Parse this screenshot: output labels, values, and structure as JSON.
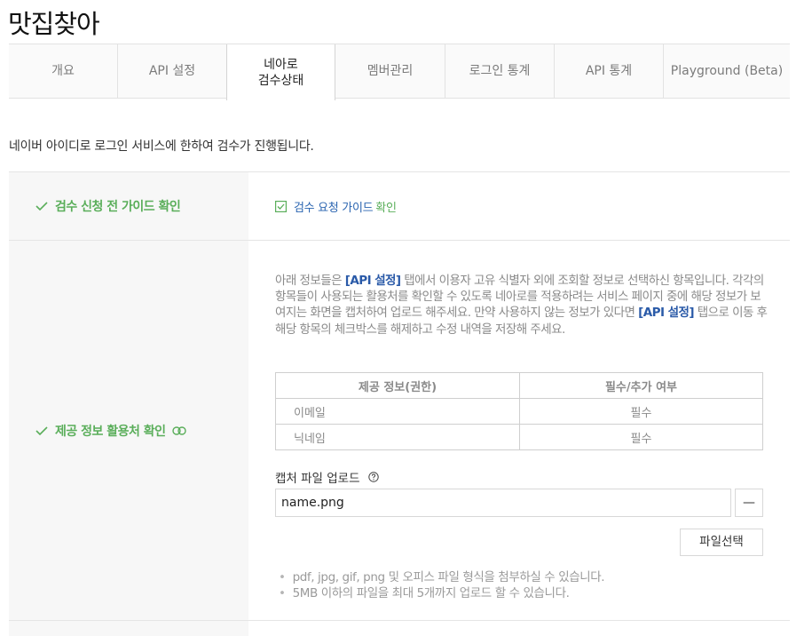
{
  "app": {
    "title": "맛집찾아"
  },
  "tabs": [
    {
      "label": "개요"
    },
    {
      "label": "API 설정"
    },
    {
      "label": "네아로\n검수상태"
    },
    {
      "label": "멤버관리"
    },
    {
      "label": "로그인 통계"
    },
    {
      "label": "API 통계"
    },
    {
      "label": "Playground (Beta)"
    }
  ],
  "active_tab_index": 2,
  "intro": "네이버 아이디로 로그인 서비스에 한하여 검수가 진행됩니다.",
  "review": {
    "guide": {
      "label": "검수 신청 전 가이드 확인",
      "link_text": "검수 요청 가이드",
      "link_confirm": "확인",
      "checked": true
    },
    "usage": {
      "label": "제공 정보 활용처 확인",
      "desc_1": "아래 정보들은 ",
      "desc_bold_1": "[API 설정]",
      "desc_2": " 탭에서 이용자 고유 식별자 외에 조회할 정보로 선택하신 항목입니다. 각각의 항목들이 사용되는 활용처를 확인할 수 있도록 네아로를 적용하려는 서비스 페이지 중에 해당 정보가 보여지는 화면을 캡처하여 업로드 해주세요. 만약 사용하지 않는 정보가 있다면 ",
      "desc_bold_2": "[API 설정]",
      "desc_3": " 탭으로 이동 후 해당 항목의 체크박스를 해제하고 수정 내역을 저장해 주세요.",
      "table": {
        "headers": [
          "제공 정보(권한)",
          "필수/추가 여부"
        ],
        "rows": [
          [
            "이메일",
            "필수"
          ],
          [
            "닉네임",
            "필수"
          ]
        ]
      },
      "upload_label": "캡처 파일 업로드",
      "file_value": "name.png",
      "remove_label": "—",
      "select_label": "파일선택",
      "notes": [
        "pdf, jpg, gif, png 및 오피스 파일 형식을 첨부하실 수 있습니다.",
        "5MB 이하의 파일을 최대 5개까지 업로드 할 수 있습니다."
      ]
    }
  },
  "colors": {
    "accent_green": "#5aae5a",
    "link_blue": "#2a64b0",
    "label_bg": "#f7f7f7"
  }
}
